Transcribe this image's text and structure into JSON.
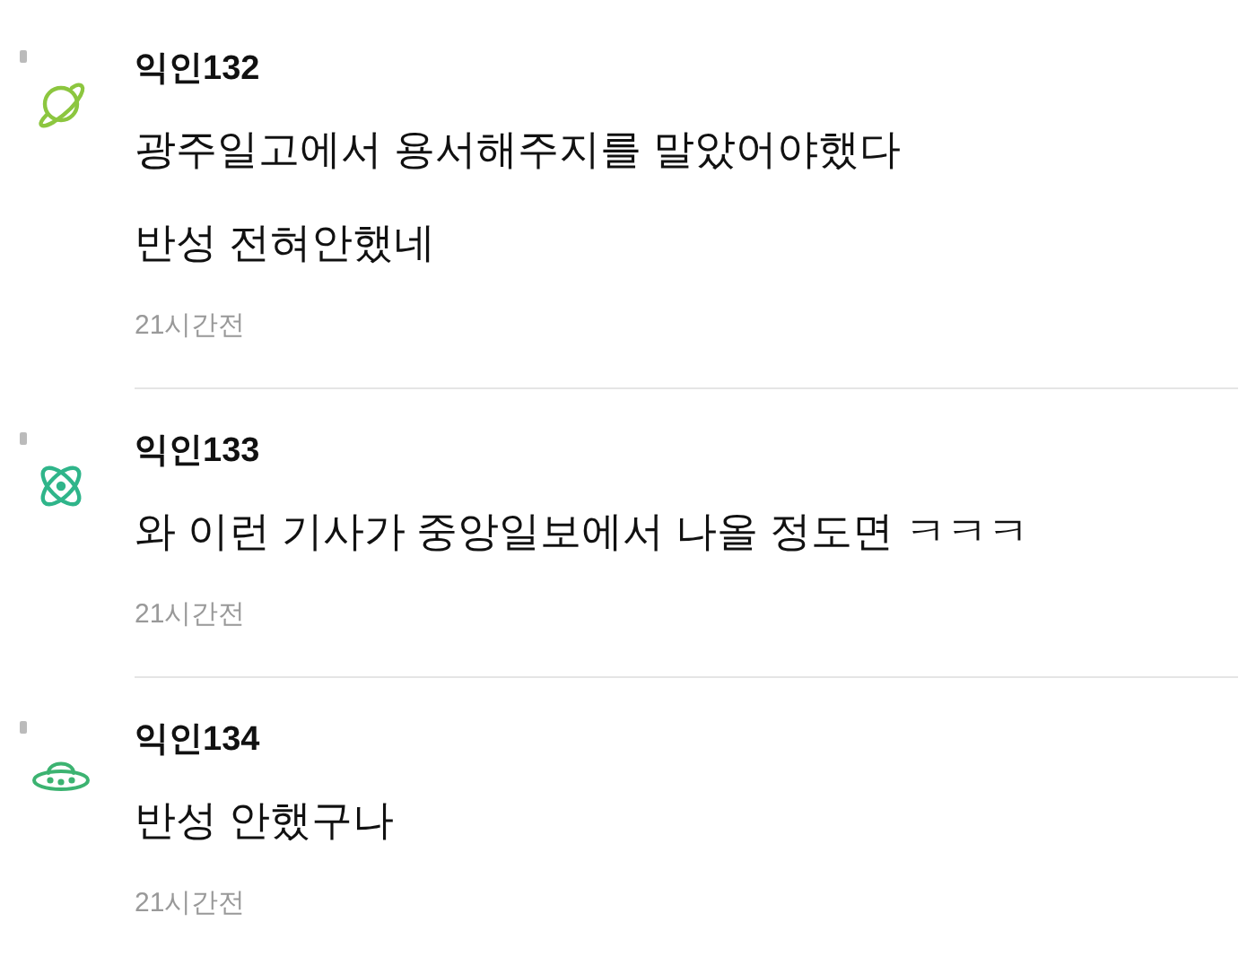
{
  "comments": [
    {
      "author": "익인132",
      "icon": {
        "kind": "planet",
        "color": "#8cc63f"
      },
      "lines": [
        "광주일고에서 용서해주지를 말았어야했다",
        "반성 전혀안했네"
      ],
      "time": "21시간전"
    },
    {
      "author": "익인133",
      "icon": {
        "kind": "atom",
        "color": "#2fb58a"
      },
      "lines": [
        "와 이런 기사가 중앙일보에서 나올 정도면 ㅋㅋㅋ"
      ],
      "time": "21시간전"
    },
    {
      "author": "익인134",
      "icon": {
        "kind": "ufo",
        "color": "#3cb371"
      },
      "lines": [
        "반성 안했구나"
      ],
      "time": "21시간전"
    }
  ]
}
